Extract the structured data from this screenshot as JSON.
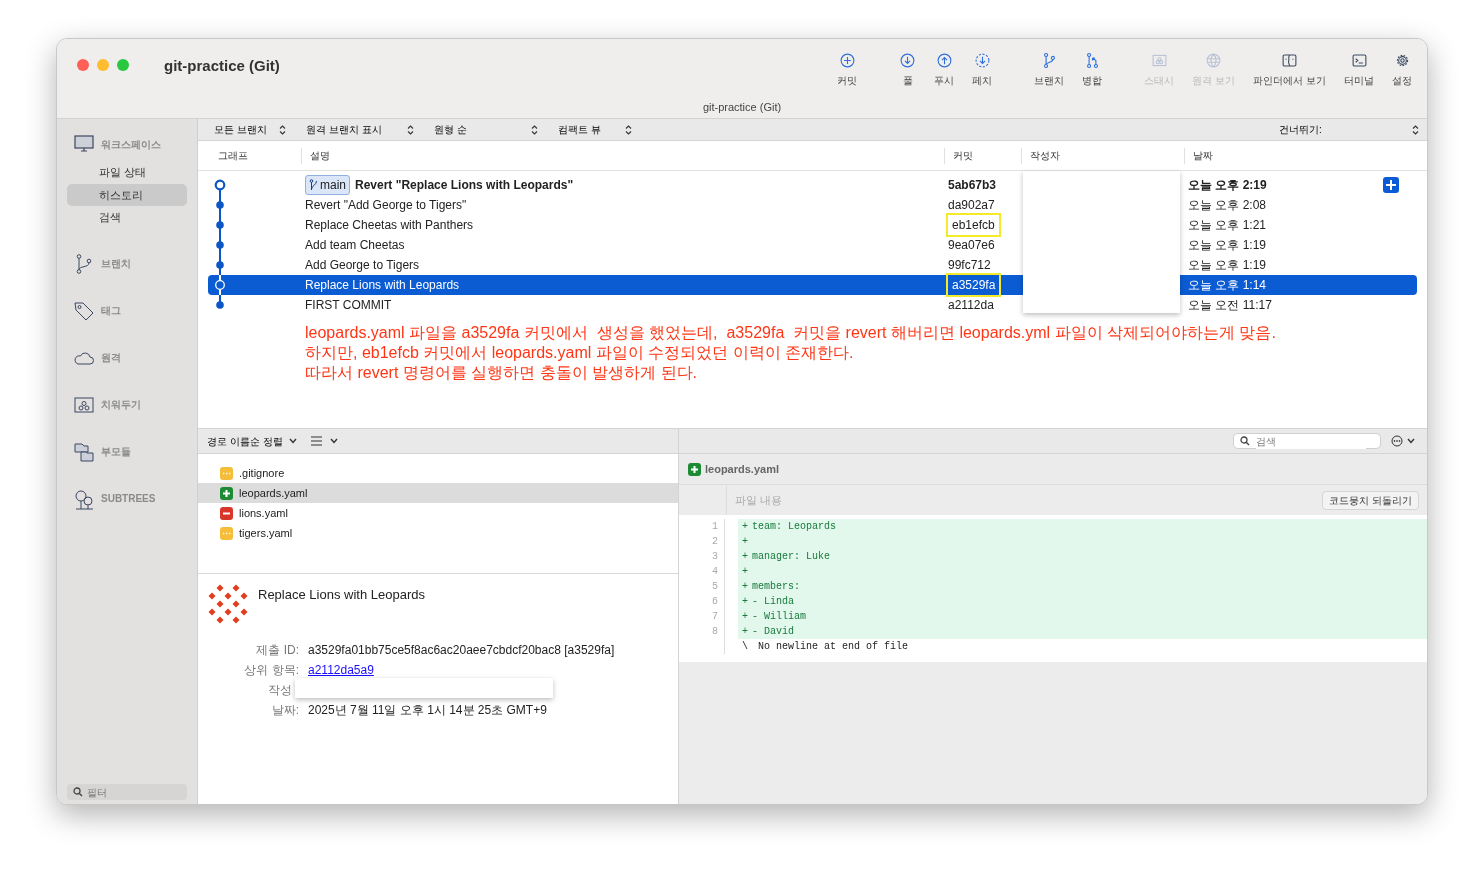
{
  "window": {
    "title": "git-practice (Git)",
    "subtitle": "git-practice (Git)"
  },
  "toolbar": [
    [
      {
        "label": "커밋",
        "disabled": false
      }
    ],
    [
      {
        "label": "풀",
        "disabled": false
      },
      {
        "label": "푸시",
        "disabled": false
      },
      {
        "label": "페치",
        "disabled": false
      }
    ],
    [
      {
        "label": "브랜치",
        "disabled": false
      },
      {
        "label": "병합",
        "disabled": false
      }
    ],
    [
      {
        "label": "스태시",
        "disabled": true
      },
      {
        "label": "원격 보기",
        "disabled": true
      },
      {
        "label": "파인더에서 보기",
        "disabled": false
      },
      {
        "label": "터미널",
        "disabled": false
      },
      {
        "label": "설정",
        "disabled": false
      }
    ]
  ],
  "sidebar": {
    "sections": [
      {
        "label": "워크스페이스",
        "children": [
          {
            "label": "파일 상태",
            "selected": false
          },
          {
            "label": "히스토리",
            "selected": true
          },
          {
            "label": "검색",
            "selected": false
          }
        ]
      },
      {
        "label": "브랜치"
      },
      {
        "label": "태그"
      },
      {
        "label": "원격"
      },
      {
        "label": "치워두기"
      },
      {
        "label": "부모듈"
      },
      {
        "label": "SUBTREES"
      }
    ],
    "filter": {
      "placeholder": "필터"
    }
  },
  "filter_bar": {
    "dropdowns": [
      "모든 브랜치",
      "원격 브랜치 표시",
      "원형 순",
      "컴팩트 뷰"
    ],
    "jump_label": "건너뛰기:"
  },
  "table": {
    "columns": [
      "그래프",
      "설명",
      "커밋",
      "작성자",
      "날짜"
    ],
    "rows": [
      {
        "branch": "main",
        "description": "Revert \"Replace Lions with Leopards\"",
        "commit": "5ab67b3",
        "date": "오늘 오후 2:19",
        "current": true,
        "selected": false,
        "highlighted": false
      },
      {
        "description": "Revert \"Add George to Tigers\"",
        "commit": "da902a7",
        "date": "오늘 오후 2:08",
        "current": false,
        "selected": false,
        "highlighted": false
      },
      {
        "description": "Replace Cheetas with Panthers",
        "commit": "eb1efcb",
        "date": "오늘 오후 1:21",
        "current": false,
        "selected": false,
        "highlighted": true
      },
      {
        "description": "Add team Cheetas",
        "commit": "9ea07e6",
        "date": "오늘 오후 1:19",
        "current": false,
        "selected": false,
        "highlighted": false
      },
      {
        "description": "Add George to Tigers",
        "commit": "99fc712",
        "date": "오늘 오후 1:19",
        "current": false,
        "selected": false,
        "highlighted": false
      },
      {
        "description": "Replace Lions with Leopards",
        "commit": "a3529fa",
        "date": "오늘 오후 1:14",
        "current": false,
        "selected": true,
        "highlighted": true
      },
      {
        "description": "FIRST COMMIT",
        "commit": "a2112da",
        "date": "오늘 오전 11:17",
        "current": false,
        "selected": false,
        "highlighted": false
      }
    ]
  },
  "annotation": [
    "leopards.yaml 파일을 a3529fa 커밋에서  생성을 했었는데,  a3529fa  커밋을 revert 해버리면 leopards.yml 파일이 삭제되어야하는게 맞음.",
    "하지만, eb1efcb 커밋에서 leopards.yaml 파일이 수정되었던 이력이 존재한다.",
    "따라서 revert 명령어를 실행하면 충돌이 발생하게 된다."
  ],
  "file_toolbar": {
    "sort": "경로 이름순 정렬"
  },
  "files": [
    {
      "name": ".gitignore",
      "kind": "modified",
      "selected": false
    },
    {
      "name": "leopards.yaml",
      "kind": "added",
      "selected": true
    },
    {
      "name": "lions.yaml",
      "kind": "deleted",
      "selected": false
    },
    {
      "name": "tigers.yaml",
      "kind": "modified",
      "selected": false
    }
  ],
  "details": {
    "title": "Replace Lions with Leopards",
    "fields": [
      {
        "kind": "text",
        "label": "제출 ID:",
        "value": "a3529fa01bb75ce5f8ac6ac20aee7cbdcf20bac8 [a3529fa]"
      },
      {
        "kind": "link",
        "label": "상위 항목:",
        "value": "a2112da5a9"
      },
      {
        "kind": "covered",
        "label": "작성"
      },
      {
        "kind": "text",
        "label": "날짜:",
        "value": "2025년 7월 11일 오후 1시 14분 25초 GMT+9"
      }
    ]
  },
  "diff": {
    "search": {
      "placeholder": "검색"
    },
    "file": {
      "name": "leopards.yaml",
      "kind": "added"
    },
    "section": "파일 내용",
    "button": "코드뭉치 되돌리기",
    "lines": [
      {
        "kind": "added",
        "number": "1",
        "marker": "+",
        "text": "team: Leopards"
      },
      {
        "kind": "added",
        "number": "2",
        "marker": "+"
      },
      {
        "kind": "added",
        "number": "3",
        "marker": "+",
        "text": "manager: Luke"
      },
      {
        "kind": "added",
        "number": "4",
        "marker": "+"
      },
      {
        "kind": "added",
        "number": "5",
        "marker": "+",
        "text": "members:"
      },
      {
        "kind": "added",
        "number": "6",
        "marker": "+",
        "text": "- Linda"
      },
      {
        "kind": "added",
        "number": "7",
        "marker": "+",
        "text": "- William"
      },
      {
        "kind": "added",
        "number": "8",
        "marker": "+",
        "text": "- David"
      },
      {
        "kind": "note",
        "marker": "\\",
        "text": "No newline at end of file"
      }
    ]
  }
}
